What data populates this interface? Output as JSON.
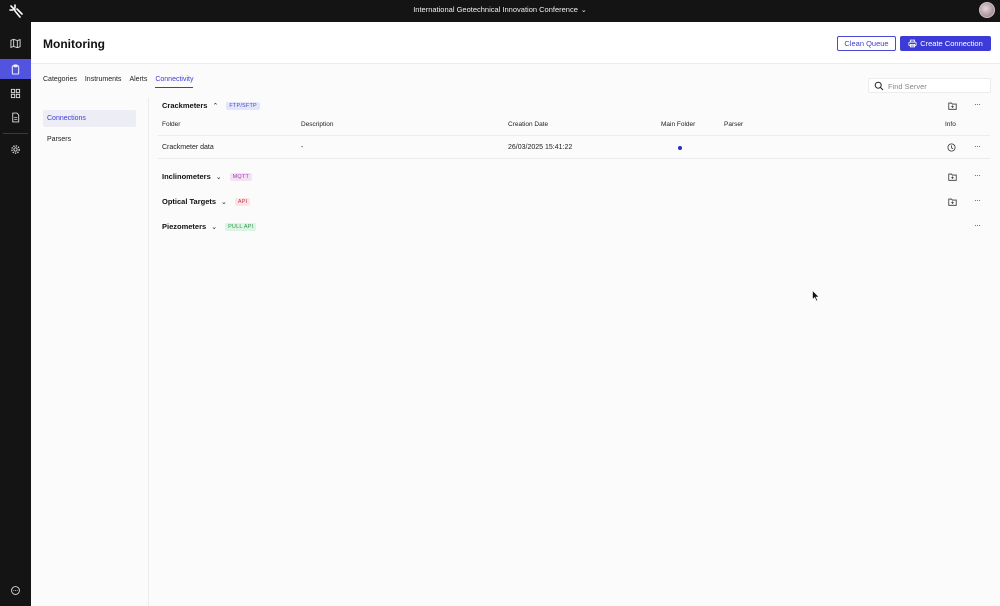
{
  "topbar": {
    "conference": "International Geotechnical Innovation Conference"
  },
  "header": {
    "title": "Monitoring",
    "clean_queue": "Clean Queue",
    "create_connection": "Create Connection"
  },
  "tabs": [
    {
      "label": "Categories"
    },
    {
      "label": "Instruments"
    },
    {
      "label": "Alerts"
    },
    {
      "label": "Connectivity",
      "active": true
    }
  ],
  "search": {
    "placeholder": "Find Server",
    "value": ""
  },
  "subnav": [
    {
      "label": "Connections",
      "active": true
    },
    {
      "label": "Parsers"
    }
  ],
  "sections": [
    {
      "title": "Crackmeters",
      "badge": "FTP/SFTP",
      "expanded": true
    },
    {
      "title": "Inclinometers",
      "badge": "MQTT",
      "expanded": false
    },
    {
      "title": "Optical Targets",
      "badge": "API",
      "expanded": false
    },
    {
      "title": "Piezometers",
      "badge": "PULL API",
      "expanded": false
    }
  ],
  "table": {
    "headers": [
      "Folder",
      "Description",
      "Creation Date",
      "Main Folder",
      "Parser",
      "Info"
    ],
    "rows": [
      {
        "folder": "Crackmeter data",
        "description": "-",
        "creation_date": "26/03/2025 15:41:22",
        "main_folder": true,
        "parser": ""
      }
    ]
  },
  "colors": {
    "accent": "#3d3bd8",
    "rail": "#141414",
    "rail_active": "#5254e0"
  }
}
